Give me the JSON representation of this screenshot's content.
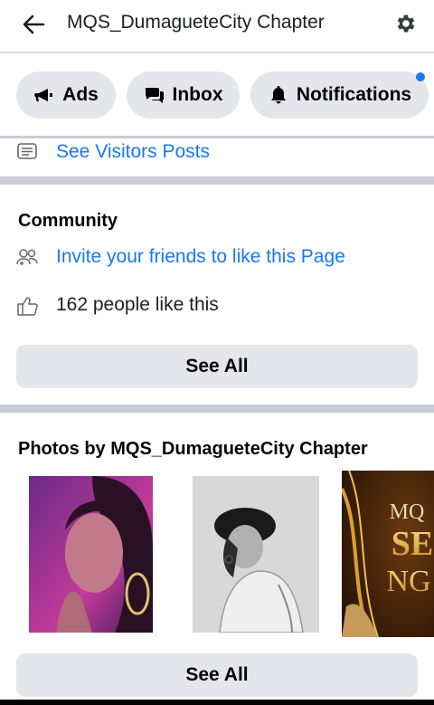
{
  "header": {
    "title": "MQS_DumagueteCity Chapter",
    "back_icon": "arrow-left-icon",
    "settings_icon": "gear-icon"
  },
  "tabs": [
    {
      "label": "Ads",
      "icon": "megaphone-icon"
    },
    {
      "label": "Inbox",
      "icon": "chat-bubbles-icon"
    },
    {
      "label": "Notifications",
      "icon": "bell-icon",
      "has_badge": true
    }
  ],
  "visitors": {
    "label": "See Visitors Posts",
    "icon": "posts-icon"
  },
  "community": {
    "title": "Community",
    "invite_label": "Invite your friends to like this Page",
    "likes_text": "162 people like this",
    "see_all_label": "See All"
  },
  "photos": {
    "title": "Photos by MQS_DumagueteCity Chapter",
    "see_all_label": "See All",
    "items": [
      {
        "alt": "Portrait photo, purple lighting"
      },
      {
        "alt": "Black and white portrait with bucket hat"
      },
      {
        "alt": "Gold event poster",
        "text1": "MQ",
        "text2": "SE",
        "text3": "NG"
      }
    ]
  },
  "colors": {
    "accent": "#1877f2",
    "pill_bg": "#e4e6eb",
    "separator": "#c9ccd1"
  }
}
